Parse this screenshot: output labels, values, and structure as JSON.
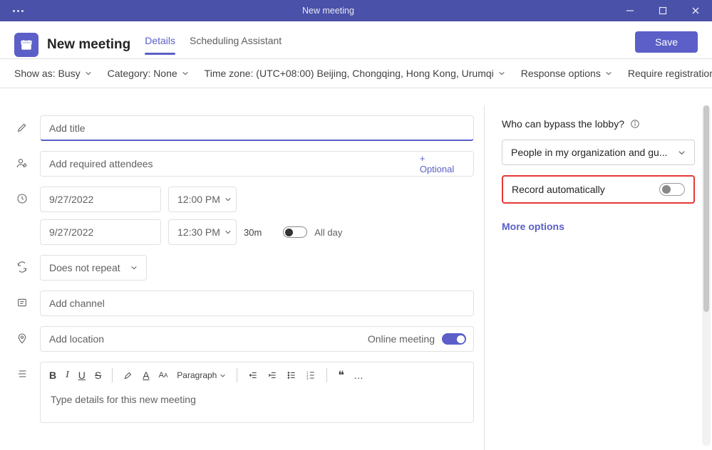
{
  "window": {
    "title": "New meeting"
  },
  "header": {
    "page_title": "New meeting",
    "tabs": {
      "details": "Details",
      "scheduling": "Scheduling Assistant"
    },
    "save": "Save"
  },
  "optbar": {
    "show_as": "Show as: Busy",
    "category": "Category: None",
    "timezone": "Time zone: (UTC+08:00) Beijing, Chongqing, Hong Kong, Urumqi",
    "response": "Response options",
    "registration": "Require registration: N"
  },
  "form": {
    "title_placeholder": "Add title",
    "attendees_placeholder": "Add required attendees",
    "optional": "+ Optional",
    "start_date": "9/27/2022",
    "start_time": "12:00 PM",
    "end_date": "9/27/2022",
    "end_time": "12:30 PM",
    "duration": "30m",
    "all_day": "All day",
    "repeat": "Does not repeat",
    "channel_placeholder": "Add channel",
    "location_placeholder": "Add location",
    "online_label": "Online meeting",
    "editor": {
      "paragraph": "Paragraph",
      "details_placeholder": "Type details for this new meeting"
    }
  },
  "side": {
    "lobby_label": "Who can bypass the lobby?",
    "lobby_value": "People in my organization and gu...",
    "record": "Record automatically",
    "more": "More options"
  }
}
